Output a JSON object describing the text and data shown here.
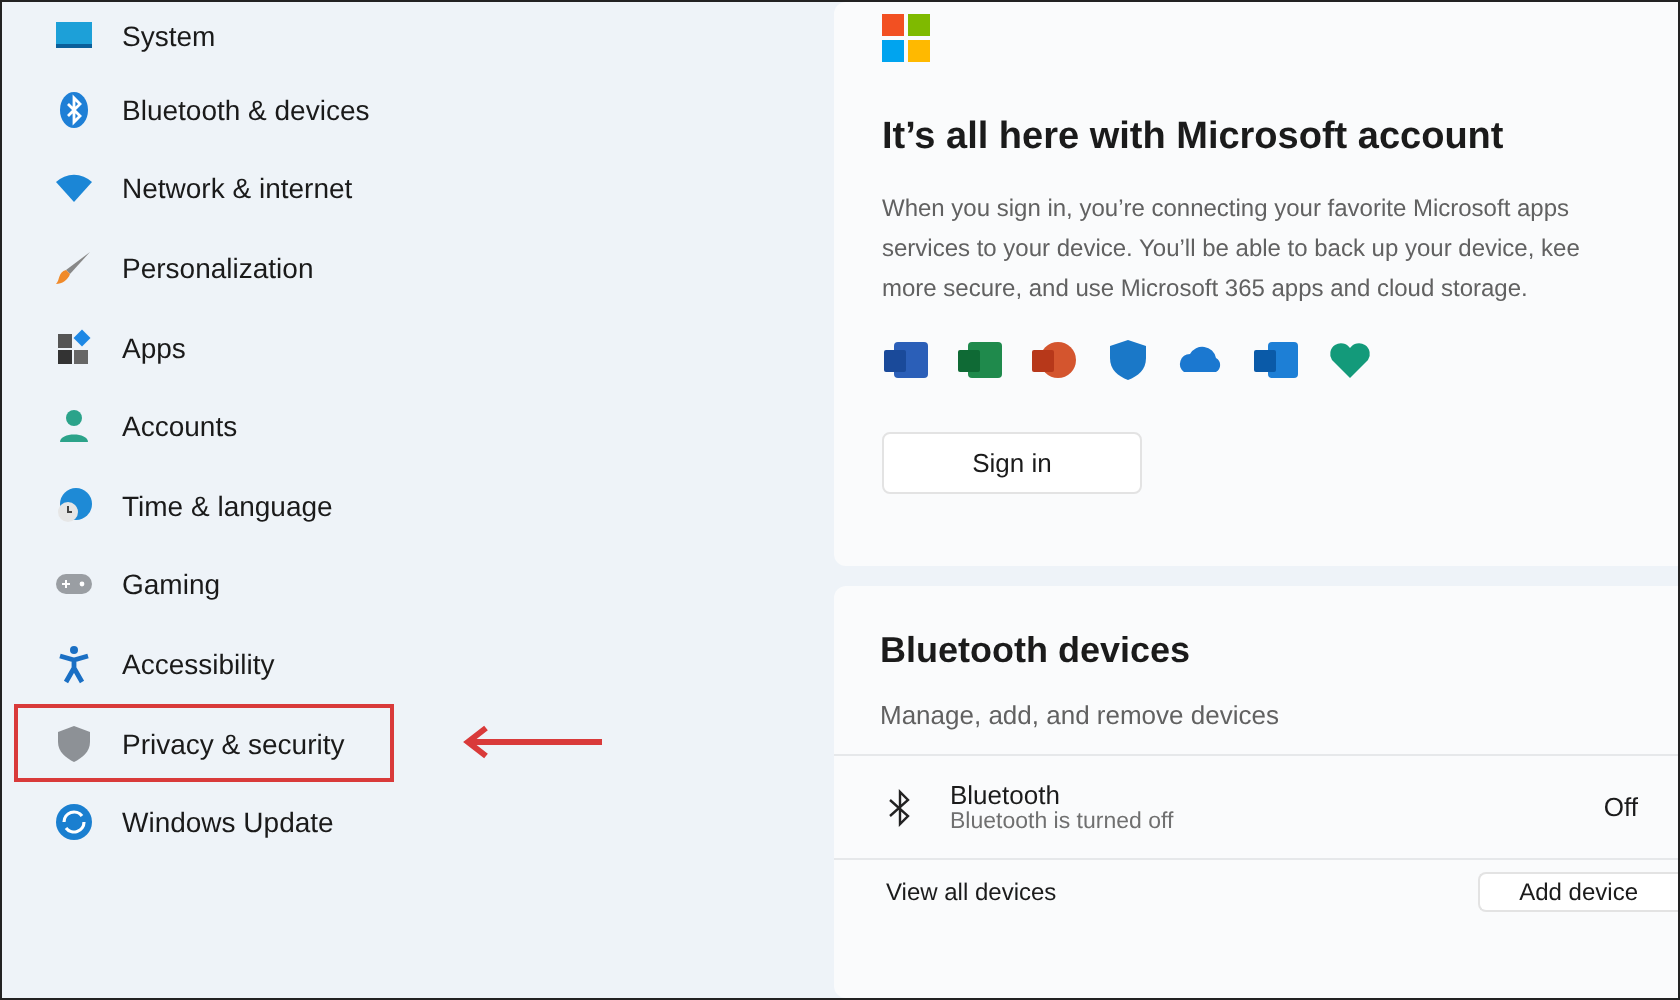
{
  "sidebar": {
    "items": [
      {
        "label": "System",
        "highlighted": false
      },
      {
        "label": "Bluetooth & devices",
        "highlighted": false
      },
      {
        "label": "Network & internet",
        "highlighted": false
      },
      {
        "label": "Personalization",
        "highlighted": false
      },
      {
        "label": "Apps",
        "highlighted": false
      },
      {
        "label": "Accounts",
        "highlighted": false
      },
      {
        "label": "Time & language",
        "highlighted": false
      },
      {
        "label": "Gaming",
        "highlighted": false
      },
      {
        "label": "Accessibility",
        "highlighted": false
      },
      {
        "label": "Privacy & security",
        "highlighted": true
      },
      {
        "label": "Windows Update",
        "highlighted": false
      }
    ]
  },
  "account_card": {
    "title": "It’s all here with Microsoft account",
    "description_lines": [
      "When you sign in, you’re connecting your favorite Microsoft apps",
      "services to your device. You’ll be able to back up your device, kee",
      "more secure, and use Microsoft 365 apps and cloud storage."
    ],
    "button": "Sign in"
  },
  "bluetooth_card": {
    "title": "Bluetooth devices",
    "subtitle": "Manage, add, and remove devices",
    "row": {
      "title": "Bluetooth",
      "subtitle": "Bluetooth is turned off",
      "status": "Off"
    },
    "footer": {
      "link": "View all devices",
      "button": "Add device"
    }
  }
}
